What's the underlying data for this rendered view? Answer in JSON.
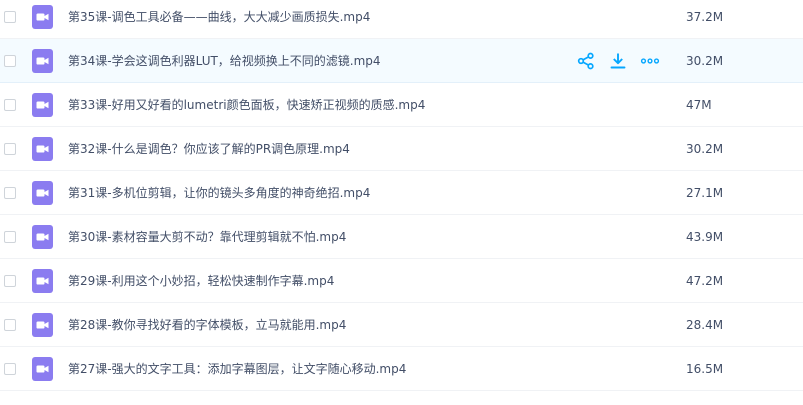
{
  "colors": {
    "accent": "#06a7ff",
    "video_icon": "#8b7cf0",
    "text": "#424e67"
  },
  "actions": {
    "share_icon": "share-icon",
    "download_icon": "download-icon",
    "more_icon": "more-icon"
  },
  "files": [
    {
      "name": "第35课-调色工具必备——曲线，大大减少画质损失.mp4",
      "size": "37.2M"
    },
    {
      "name": "第34课-学会这调色利器LUT，给视频换上不同的滤镜.mp4",
      "size": "30.2M"
    },
    {
      "name": "第33课-好用又好看的lumetri颜色面板，快速矫正视频的质感.mp4",
      "size": "47M"
    },
    {
      "name": "第32课-什么是调色？你应该了解的PR调色原理.mp4",
      "size": "30.2M"
    },
    {
      "name": "第31课-多机位剪辑，让你的镜头多角度的神奇绝招.mp4",
      "size": "27.1M"
    },
    {
      "name": "第30课-素材容量大剪不动？靠代理剪辑就不怕.mp4",
      "size": "43.9M"
    },
    {
      "name": "第29课-利用这个小妙招，轻松快速制作字幕.mp4",
      "size": "47.2M"
    },
    {
      "name": "第28课-教你寻找好看的字体模板，立马就能用.mp4",
      "size": "28.4M"
    },
    {
      "name": "第27课-强大的文字工具：添加字幕图层，让文字随心移动.mp4",
      "size": "16.5M"
    }
  ]
}
